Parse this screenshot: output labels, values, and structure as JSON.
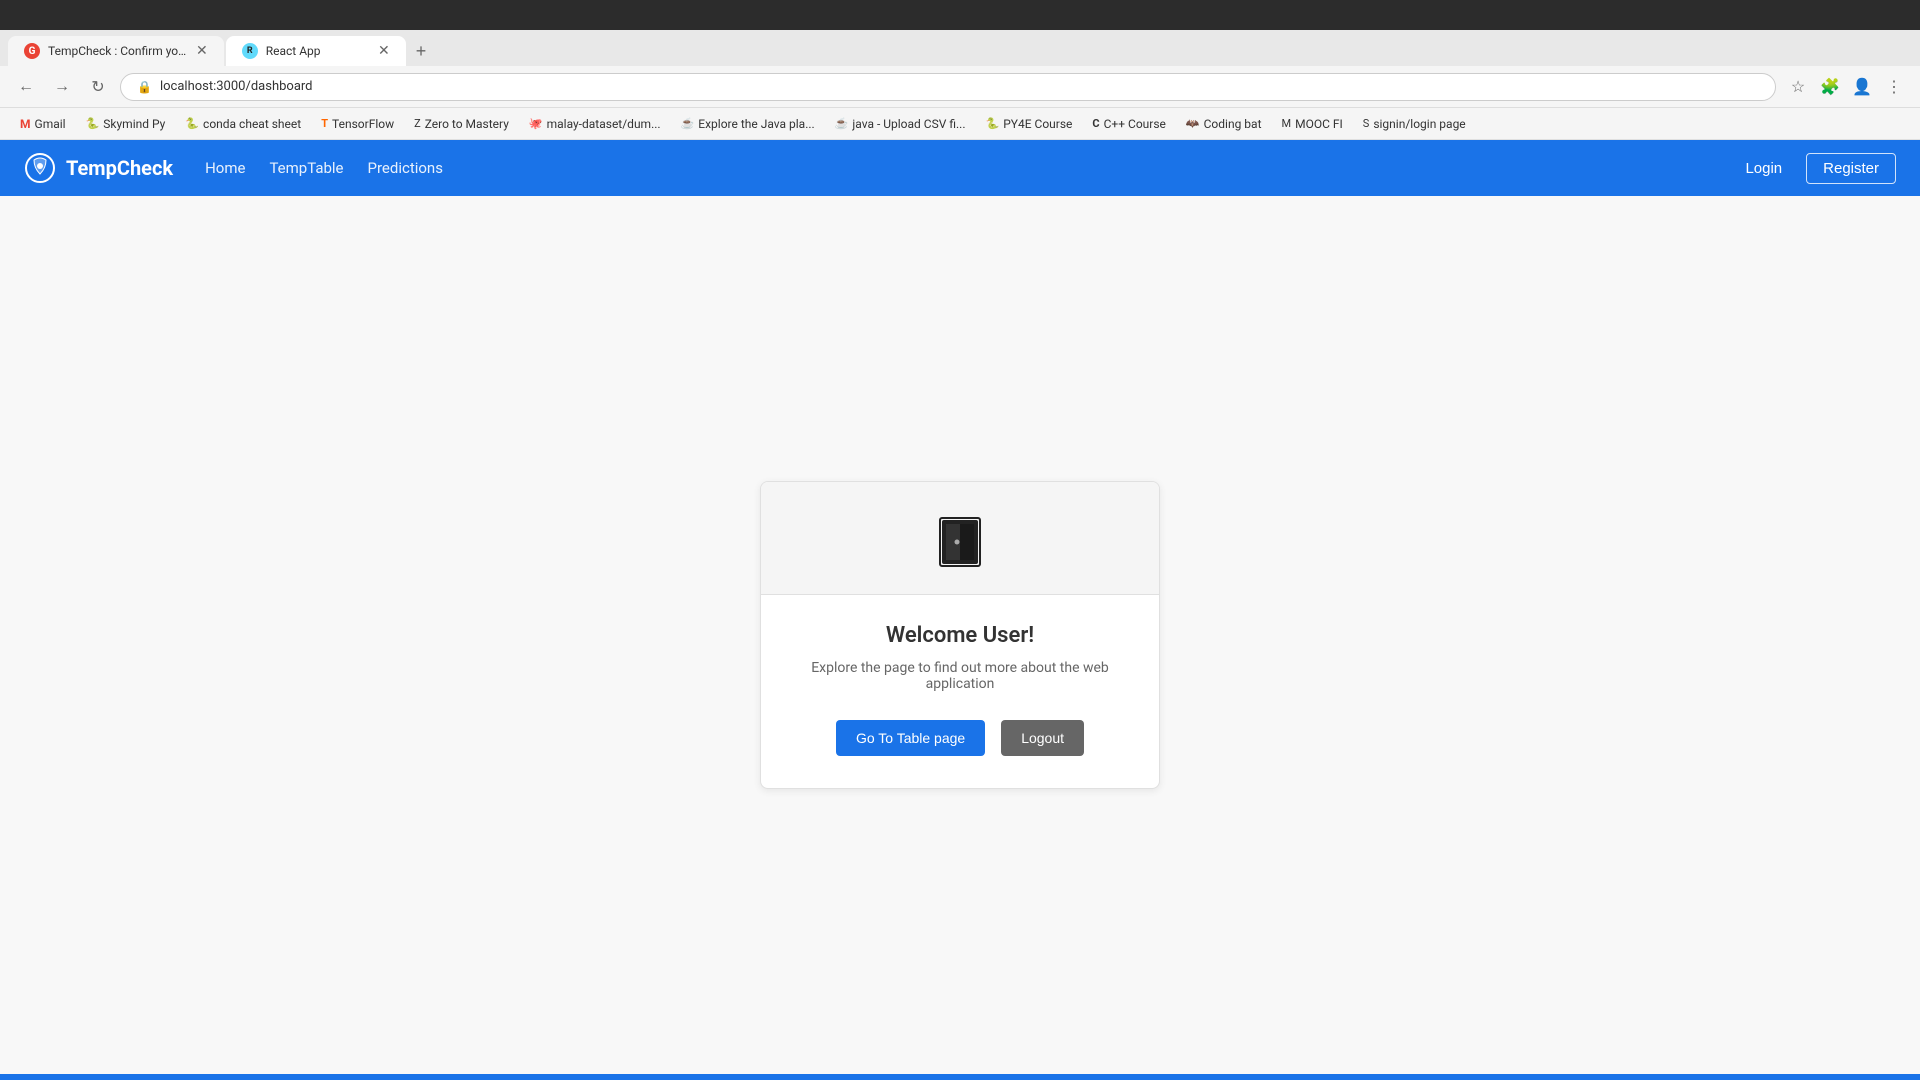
{
  "browser": {
    "tabs": [
      {
        "id": "tab-tempcheck",
        "label": "TempCheck : Confirm your emai...",
        "icon_color": "#ea4335",
        "active": false
      },
      {
        "id": "tab-react",
        "label": "React App",
        "icon_color": "#61dafb",
        "active": true
      }
    ],
    "address": "localhost:3000/dashboard",
    "bookmarks": [
      {
        "id": "gmail",
        "label": "Gmail",
        "icon": "G"
      },
      {
        "id": "skymindpy",
        "label": "Skymind Py",
        "icon": "S"
      },
      {
        "id": "conda",
        "label": "conda cheat sheet",
        "icon": "🐍"
      },
      {
        "id": "tensorflow",
        "label": "TensorFlow",
        "icon": "T"
      },
      {
        "id": "zerotomastery",
        "label": "Zero to Mastery",
        "icon": "Z"
      },
      {
        "id": "malay",
        "label": "malay-dataset/dum...",
        "icon": "M"
      },
      {
        "id": "java",
        "label": "Explore the Java pla...",
        "icon": "J"
      },
      {
        "id": "javaupload",
        "label": "java - Upload CSV fi...",
        "icon": "J"
      },
      {
        "id": "py4e",
        "label": "PY4E Course",
        "icon": "P"
      },
      {
        "id": "cpp",
        "label": "C++ Course",
        "icon": "C"
      },
      {
        "id": "codingbat",
        "label": "Coding bat",
        "icon": "🦇"
      },
      {
        "id": "moocfi",
        "label": "MOOC FI",
        "icon": "M"
      },
      {
        "id": "signin",
        "label": "signin/login page",
        "icon": "S"
      }
    ]
  },
  "navbar": {
    "brand": "TempCheck",
    "links": [
      {
        "id": "home",
        "label": "Home"
      },
      {
        "id": "temptable",
        "label": "TempTable"
      },
      {
        "id": "predictions",
        "label": "Predictions"
      }
    ],
    "login_label": "Login",
    "register_label": "Register"
  },
  "card": {
    "welcome_title": "Welcome User!",
    "welcome_desc": "Explore the page to find out more about the web application",
    "goto_table_label": "Go To Table page",
    "logout_label": "Logout"
  }
}
